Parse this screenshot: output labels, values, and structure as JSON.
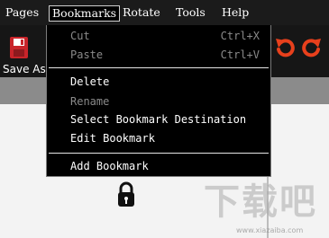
{
  "menubar": {
    "items": [
      {
        "label": "Pages"
      },
      {
        "label": "Bookmarks"
      },
      {
        "label": "Rotate"
      },
      {
        "label": "Tools"
      },
      {
        "label": "Help"
      }
    ],
    "active": "Bookmarks"
  },
  "toolbar": {
    "save_label": "Save As",
    "icons": [
      "save-icon",
      "undo-icon",
      "redo-icon"
    ],
    "accent_color": "#e8401c"
  },
  "bookmarks_menu": {
    "items": [
      {
        "label": "Cut",
        "shortcut": "Ctrl+X",
        "enabled": false
      },
      {
        "label": "Paste",
        "shortcut": "Ctrl+V",
        "enabled": false
      },
      {
        "label": "Delete",
        "enabled": true
      },
      {
        "label": "Rename",
        "enabled": false
      },
      {
        "label": "Select Bookmark Destination",
        "enabled": true
      },
      {
        "label": "Edit Bookmark",
        "enabled": true
      },
      {
        "label": "Add Bookmark",
        "enabled": true
      }
    ]
  },
  "document": {
    "icon": "lock-icon",
    "watermark_text": "下载吧",
    "watermark_url": "www.xiazaiba.com"
  }
}
